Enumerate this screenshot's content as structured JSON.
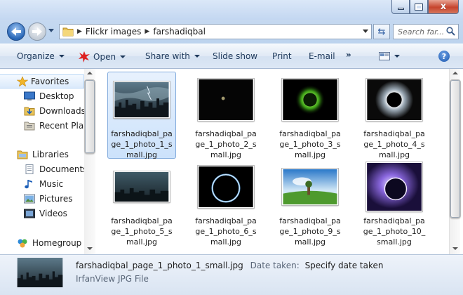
{
  "window": {
    "minimize": "–",
    "maximize": "□",
    "close": "x"
  },
  "address": {
    "crumbs": [
      "Flickr images",
      "farshadiqbal"
    ],
    "search_placeholder": "Search far..."
  },
  "toolbar": {
    "organize": "Organize",
    "open": "Open",
    "share": "Share with",
    "slideshow": "Slide show",
    "print": "Print",
    "email": "E-mail",
    "more": "»",
    "help": "?"
  },
  "nav": {
    "favorites": "Favorites",
    "desktop": "Desktop",
    "downloads": "Downloads",
    "recent": "Recent Places",
    "libraries": "Libraries",
    "documents": "Documents",
    "music": "Music",
    "pictures": "Pictures",
    "videos": "Videos",
    "homegroup": "Homegroup"
  },
  "files": [
    {
      "name": "farshadiqbal_page_1_photo_1_small.jpg",
      "icon": "photo-storm-city"
    },
    {
      "name": "farshadiqbal_page_1_photo_2_small.jpg",
      "icon": "photo-moon-dark"
    },
    {
      "name": "farshadiqbal_page_1_photo_3_small.jpg",
      "icon": "photo-green-eclipse"
    },
    {
      "name": "farshadiqbal_page_1_photo_4_small.jpg",
      "icon": "photo-black-eclipse"
    },
    {
      "name": "farshadiqbal_page_1_photo_5_small.jpg",
      "icon": "photo-dark-city"
    },
    {
      "name": "farshadiqbal_page_1_photo_6_small.jpg",
      "icon": "photo-ring-eclipse"
    },
    {
      "name": "farshadiqbal_page_1_photo_9_small.jpg",
      "icon": "photo-field-sky"
    },
    {
      "name": "farshadiqbal_page_1_photo_10_small.jpg",
      "icon": "photo-purple-eclipse"
    }
  ],
  "details": {
    "filename": "farshadiqbal_page_1_photo_1_small.jpg",
    "date_label": "Date taken:",
    "date_value": "Specify date taken",
    "type": "IrfanView JPG File"
  }
}
